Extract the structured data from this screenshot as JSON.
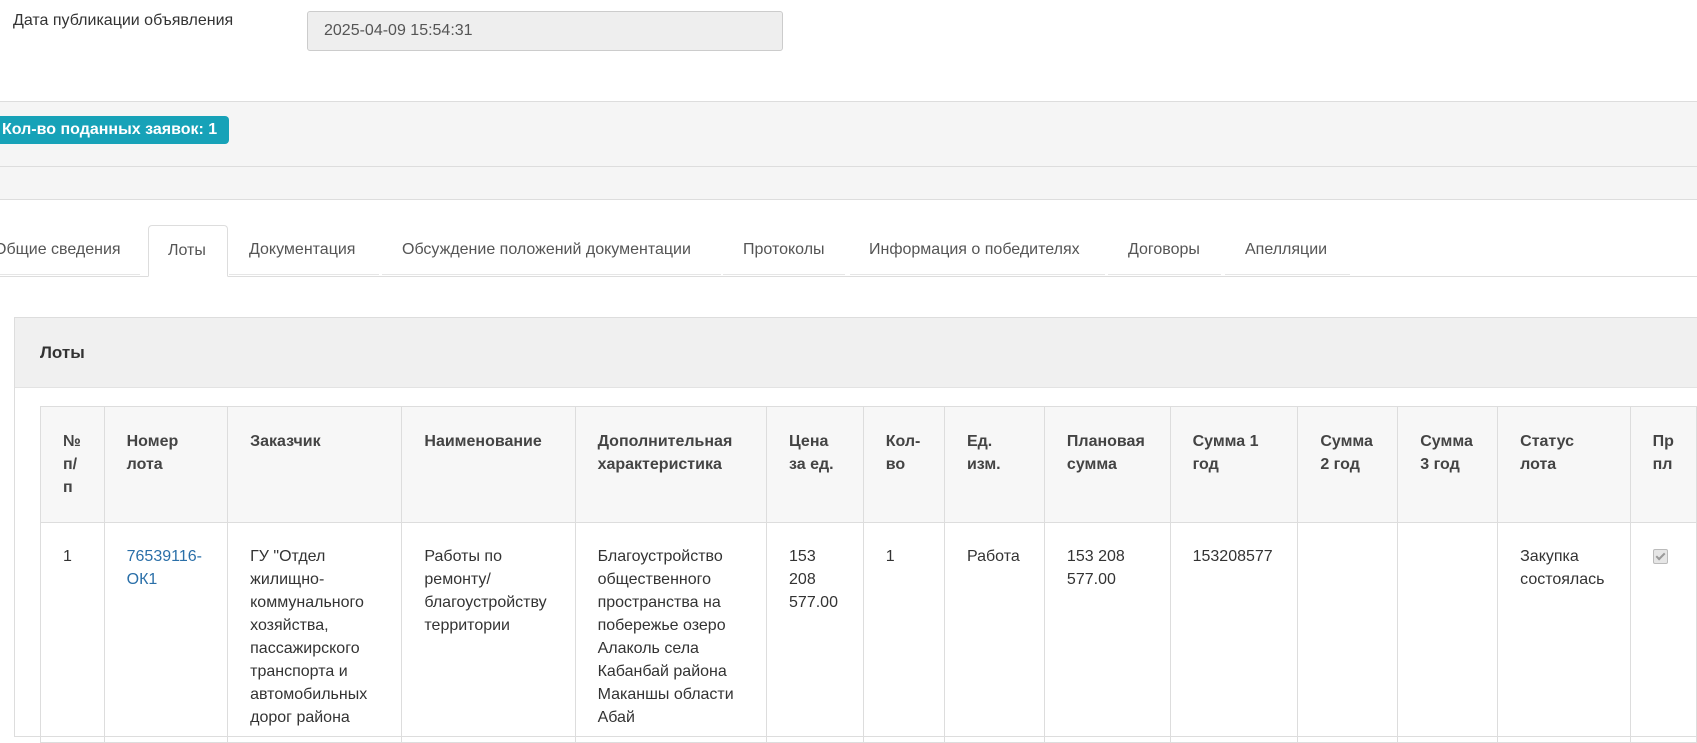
{
  "publication": {
    "label": "Дата публикации объявления",
    "value": "2025-04-09 15:54:31"
  },
  "applications_badge": "Кол-во поданных заявок: 1",
  "tabs": [
    {
      "label": "Общие сведения",
      "active": false
    },
    {
      "label": "Лоты",
      "active": true
    },
    {
      "label": "Документация",
      "active": false
    },
    {
      "label": "Обсуждение положений документации",
      "active": false
    },
    {
      "label": "Протоколы",
      "active": false
    },
    {
      "label": "Информация о победителях",
      "active": false
    },
    {
      "label": "Договоры",
      "active": false
    },
    {
      "label": "Апелляции",
      "active": false
    }
  ],
  "panel": {
    "title": "Лоты"
  },
  "table": {
    "headers": [
      "№ п/п",
      "Номер лота",
      "Заказчик",
      "Наименование",
      "Дополнительная характеристика",
      "Цена за ед.",
      "Кол-во",
      "Ед. изм.",
      "Плановая сумма",
      "Сумма 1 год",
      "Сумма 2 год",
      "Сумма 3 год",
      "Статус лота",
      "Пр пл"
    ],
    "rows": [
      {
        "num": "1",
        "lot_number": "76539116-ОК1",
        "customer": "ГУ \"Отдел жилищно-коммунального хозяйства, пассажирского транспорта и автомобильных дорог района",
        "name": "Работы по ремонту/ благоустройству территории",
        "description": "Благоустройство общественного пространства на побережье озеро Алаколь села Кабанбай района Маканшы области Абай",
        "unit_price": "153 208 577.00",
        "quantity": "1",
        "unit": "Работа",
        "planned_sum": "153 208 577.00",
        "sum_year1": "153208577",
        "sum_year2": "",
        "sum_year3": "",
        "status": "Закупка состоялась",
        "checked": true
      }
    ]
  },
  "colors": {
    "badge": "#17a2b8",
    "link": "#2a6fa8",
    "band": "#f5f5f5"
  }
}
